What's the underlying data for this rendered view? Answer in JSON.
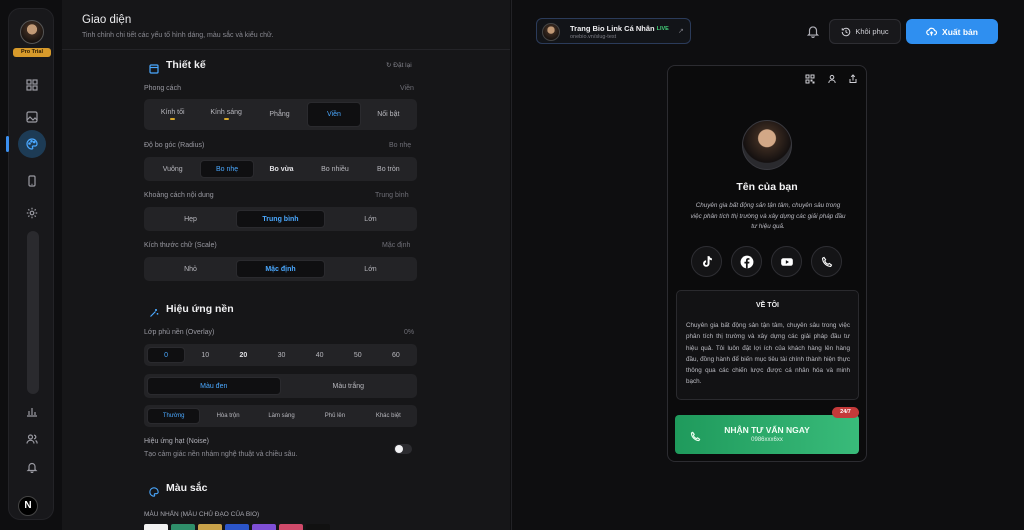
{
  "sidebar": {
    "badge": "Pro Trial",
    "items": [
      {
        "icon": "grid-icon",
        "name": "blocks"
      },
      {
        "icon": "image-icon",
        "name": "media"
      },
      {
        "icon": "palette-icon",
        "name": "appearance",
        "active": true
      },
      {
        "icon": "phone-icon",
        "name": "mobile"
      },
      {
        "icon": "gear-icon",
        "name": "settings"
      },
      {
        "icon": "bar-chart-icon",
        "name": "analytics"
      },
      {
        "icon": "users-icon",
        "name": "audience"
      },
      {
        "icon": "bell-icon",
        "name": "notifications"
      }
    ],
    "bottom_button": "N"
  },
  "panel": {
    "title": "Giao diện",
    "subtitle": "Tinh chỉnh chi tiết các yếu tố hình dáng, màu sắc và kiểu chữ.",
    "design": {
      "title": "Thiết kế",
      "reset": "Đặt lại",
      "style": {
        "label": "Phong cách",
        "value": "Viền",
        "options": [
          "Kính tối",
          "Kính sáng",
          "Phẳng",
          "Viền",
          "Nổi bật"
        ]
      },
      "radius": {
        "label": "Độ bo góc (Radius)",
        "value": "Bo nhẹ",
        "options": [
          "Vuông",
          "Bo nhẹ",
          "Bo vừa",
          "Bo nhiều",
          "Bo tròn"
        ]
      },
      "spacing": {
        "label": "Khoảng cách nội dung",
        "value": "Trung bình",
        "options": [
          "Hẹp",
          "Trung bình",
          "Lớn"
        ]
      },
      "scale": {
        "label": "Kích thước chữ (Scale)",
        "value": "Mặc định",
        "options": [
          "Nhỏ",
          "Mặc định",
          "Lớn"
        ]
      }
    },
    "background": {
      "title": "Hiệu ứng nền",
      "overlay": {
        "label": "Lớp phủ nền (Overlay)",
        "value": "0%",
        "options": [
          "0",
          "10",
          "20",
          "30",
          "40",
          "50",
          "60"
        ]
      },
      "overlay_color": {
        "options": [
          "Màu đen",
          "Màu trắng"
        ]
      },
      "blend": {
        "options": [
          "Thường",
          "Hòa trộn",
          "Làm sáng",
          "Phủ lên",
          "Khác biệt"
        ]
      },
      "noise": {
        "label": "Hiệu ứng hạt (Noise)",
        "hint": "Tạo cảm giác nền nhám nghệ thuật và chiều sâu.",
        "enabled": true
      }
    },
    "colors": {
      "title": "Màu sắc",
      "accent_label": "MÀU NHẤN (MÀU CHỦ ĐẠO CỦA BIO)",
      "swatches": [
        "#f2f2f2",
        "#2f8f6a",
        "#c9a24a",
        "#2b55c9",
        "#7e4fd6",
        "#d04a6a",
        "#111111"
      ]
    }
  },
  "topbar": {
    "page_name": "Trang Bio Link Cá Nhân",
    "live": "LIVE",
    "url": "onebio.vn/slug-test",
    "restore": "Khôi phục",
    "publish": "Xuất bản"
  },
  "preview": {
    "name": "Tên của bạn",
    "bio": "Chuyên gia bất động sản tận tâm, chuyên sâu trong việc phân tích thị trường và xây dựng các giải pháp đầu tư hiệu quả.",
    "socials": [
      "tiktok-icon",
      "facebook-icon",
      "youtube-icon",
      "phone-icon"
    ],
    "about_title": "VỀ TÔI",
    "about_text": "Chuyên gia bất động sản tận tâm, chuyên sâu trong việc phân tích thị trường và xây dựng các giải pháp đầu tư hiệu quả. Tôi luôn đặt lợi ích của khách hàng lên hàng đầu, đồng hành để biến mục tiêu tài chính thành hiện thực thông qua các chiến lược được cá nhân hóa và minh bạch.",
    "cta_label": "NHẬN TƯ VẤN NGAY",
    "cta_phone": "0986xxx6xx",
    "cta_badge": "24/7"
  },
  "colors": {
    "accent": "#4aa8ff",
    "publish": "#2f8ff0",
    "cta": "#1f9a5c",
    "pro_badge": "#d79a2b",
    "live": "#43d17a"
  }
}
